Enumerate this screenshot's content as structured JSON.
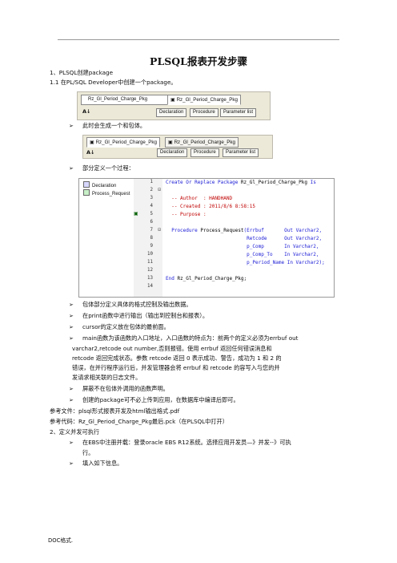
{
  "title": "PLSQL报表开发步骤",
  "sections": {
    "s1": "1、PLSQL创建package",
    "s1_1": "1.1 在PL/SQL Developer中创建一个package。",
    "b_create": "此时会生成一个和包体。",
    "b_define": "部分定义一个过程：",
    "b_list": [
      "包体部分定义具体的格式控制及输出数据。",
      "在print函数中进行输出（输出到控制台和报表）。",
      "cursor的定义放在包体的最前面。",
      "main函数为该函数的入口地址，入口函数的特点为：前两个的定义必须为errbuf out"
    ],
    "b_cont": [
      "varchar2,retcode out number,否则报错。使用 errbuf 返回任何错误消息和",
      "retcode 返回完成状态。参数 retcode 返回 0 表示成功、警告，成功为 1 和 2 的",
      "错误，在并行程序运行后，并发管理器会将 errbuf 和 retcode 的容写入与您的并",
      "发请求相关联的日志文件。"
    ],
    "b_list2": [
      "屏蔽不在包体外调用的函数声明。",
      "创建的package可不必上传到应用，在数据库中编译后即可。"
    ],
    "ref_file": "参考文件：plsql形式报表开发及html输出格式.pdf",
    "ref_code": "参考代码：Rz_Gl_Period_Charge_Pkg最后.pck（在PLSQL中打开）",
    "s2": "2、定义并发可执行",
    "b_s2": "在EBS中注册并载：登录oracle EBS R12系统。选择应用开发员—》并发--》可执",
    "b_s2_cont": "行。",
    "b_s2_2": "填入如下信息。"
  },
  "toolbar1": {
    "box_text": "Rz_Gl_Period_Charge_Pkg",
    "tab_text": "Rz_Gl_Period_Charge_Pkg",
    "buttons": [
      "Declaration",
      "Procedure",
      "Parameter list"
    ]
  },
  "toolbar2": {
    "tab_a": "Rz_Gl_Period_Charge_Pkg",
    "tab_b": "Rz_Gl_Period_Charge_Pkg",
    "buttons": [
      "Declaration",
      "Procedure",
      "Parameter list"
    ]
  },
  "sort_icon_text": "A↓",
  "code_window": {
    "tree": [
      "Declaration",
      "Process_Request"
    ],
    "lines": [
      "1",
      "2",
      "3",
      "4",
      "5",
      "6",
      "7",
      "8",
      "9",
      "10",
      "11",
      "12",
      "13",
      "14"
    ],
    "code": {
      "l1_kw": "Create Or Replace Package ",
      "l1_id": "Rz_Gl_Period_Charge_Pkg",
      "l1_kw2": " Is",
      "l3": "  -- Author  : HANDHAND",
      "l4": "  -- Created : 2011/8/6 8:58:15",
      "l5": "  -- Purpose :",
      "l7_kw": "  Procedure ",
      "l7_id": "Process_Request",
      "l7_rest": "(Errbuf       Out Varchar2,",
      "l8": "                            Retcode      Out Varchar2,",
      "l9": "                            p_Comp       In Varchar2,",
      "l10": "                            p_Comp_To    In Varchar2,",
      "l11": "                            p_Period_Name In Varchar2);",
      "l13_kw": "End ",
      "l13_id": "Rz_Gl_Period_Charge_Pkg;"
    }
  },
  "footer": "DOC格式."
}
